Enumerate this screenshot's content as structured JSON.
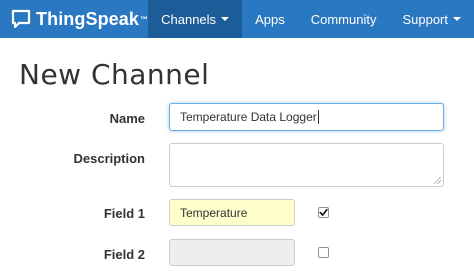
{
  "navbar": {
    "brand": "ThingSpeak",
    "brand_tm": "™",
    "items": [
      {
        "label": "Channels",
        "active": true,
        "has_caret": true
      },
      {
        "label": "Apps"
      },
      {
        "label": "Community"
      },
      {
        "label": "Support",
        "has_caret": true
      }
    ],
    "colors": {
      "bar": "#2b78c2",
      "active": "#1c5d99"
    }
  },
  "page": {
    "title": "New Channel"
  },
  "form": {
    "name_label": "Name",
    "name_value": "Temperature Data Logger",
    "description_label": "Description",
    "description_value": "",
    "field1_label": "Field 1",
    "field1_value": "Temperature",
    "field1_checked": true,
    "field2_label": "Field 2",
    "field2_value": "",
    "field2_checked": false
  },
  "icons": {
    "brand": "chat-bubble-icon",
    "caret": "caret-down-icon",
    "check": "check-icon"
  }
}
